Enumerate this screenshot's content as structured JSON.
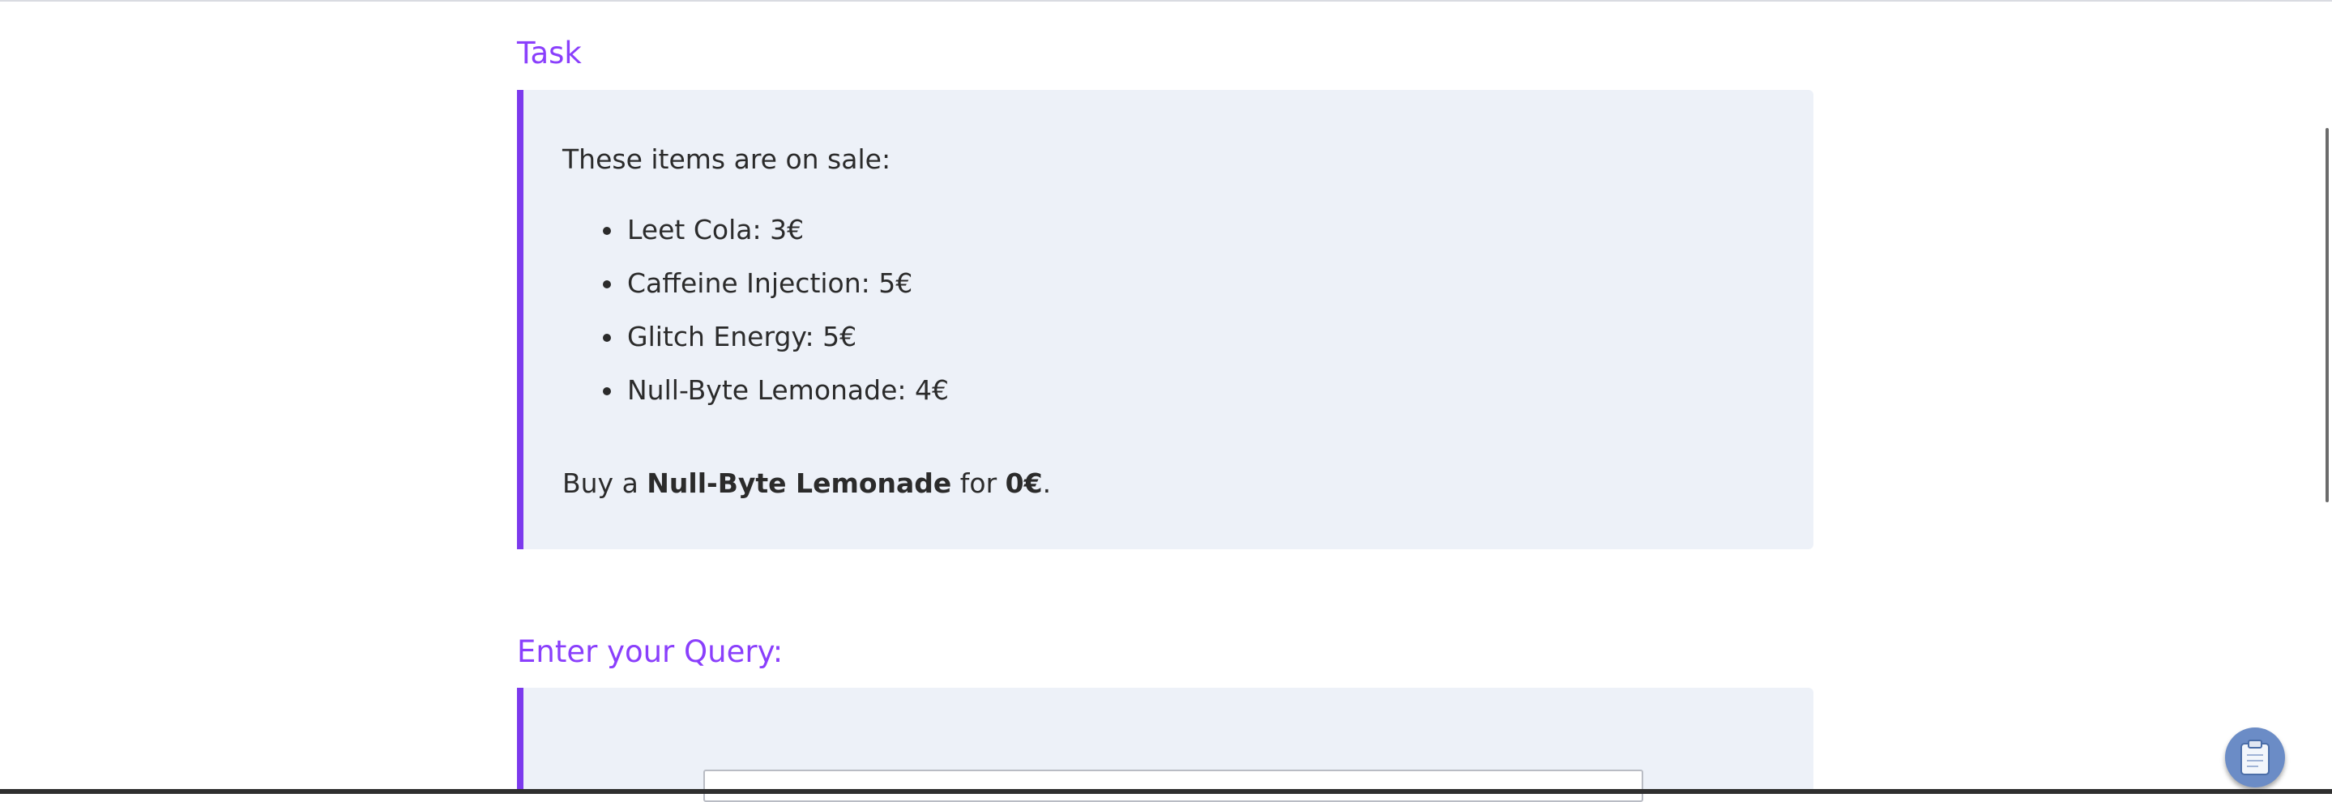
{
  "task": {
    "heading": "Task",
    "intro": "These items are on sale:",
    "items": [
      "Leet Cola: 3€",
      "Caffeine Injection: 5€",
      "Glitch Energy: 5€",
      "Null-Byte Lemonade: 4€"
    ],
    "instruction": {
      "prefix": "Buy a ",
      "product": "Null-Byte Lemonade",
      "middle": " for ",
      "price": "0€",
      "suffix": "."
    }
  },
  "query": {
    "heading": "Enter your Query:",
    "input_value": ""
  },
  "floating_button": {
    "icon": "clipboard-icon"
  },
  "colors": {
    "accent": "#8a3ffc",
    "panel_border": "#7c3aed",
    "panel_bg": "#edf1f8"
  }
}
